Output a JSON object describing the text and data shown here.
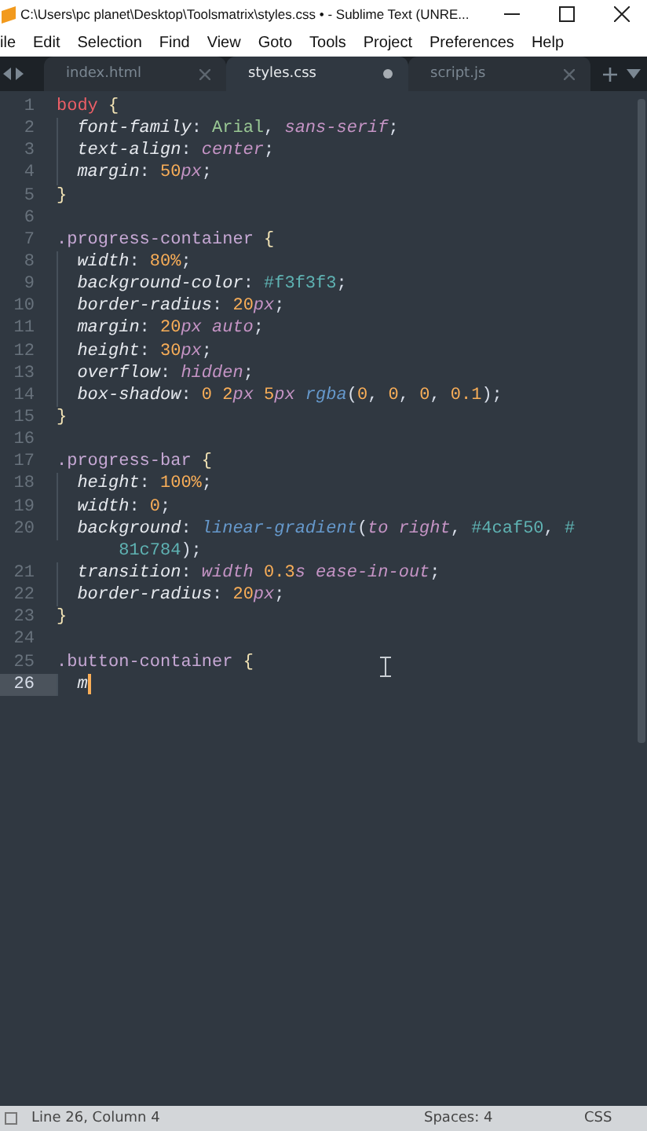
{
  "window": {
    "title": "C:\\Users\\pc planet\\Desktop\\Toolsmatrix\\styles.css • - Sublime Text (UNRE..."
  },
  "menu": [
    "ile",
    "Edit",
    "Selection",
    "Find",
    "View",
    "Goto",
    "Tools",
    "Project",
    "Preferences",
    "Help"
  ],
  "tabs": [
    {
      "label": "index.html",
      "selected": false,
      "dirty": false
    },
    {
      "label": "styles.css",
      "selected": true,
      "dirty": true
    },
    {
      "label": "script.js",
      "selected": false,
      "dirty": false
    }
  ],
  "editor": {
    "lines": [
      {
        "number": "1",
        "indent": false,
        "current": false,
        "tokens": [
          {
            "text": "body",
            "kind": "tag"
          },
          {
            "text": " {",
            "kind": "brace"
          }
        ]
      },
      {
        "number": "2",
        "indent": true,
        "current": false,
        "tokens": [
          {
            "text": "font-family",
            "kind": "prop"
          },
          {
            "text": ": ",
            "kind": "punct"
          },
          {
            "text": "Arial",
            "kind": "str"
          },
          {
            "text": ", ",
            "kind": "punct"
          },
          {
            "text": "sans-serif",
            "kind": "kw"
          },
          {
            "text": ";",
            "kind": "punct"
          }
        ]
      },
      {
        "number": "3",
        "indent": true,
        "current": false,
        "tokens": [
          {
            "text": "text-align",
            "kind": "prop"
          },
          {
            "text": ": ",
            "kind": "punct"
          },
          {
            "text": "center",
            "kind": "kw"
          },
          {
            "text": ";",
            "kind": "punct"
          }
        ]
      },
      {
        "number": "4",
        "indent": true,
        "current": false,
        "tokens": [
          {
            "text": "margin",
            "kind": "prop"
          },
          {
            "text": ": ",
            "kind": "punct"
          },
          {
            "text": "50",
            "kind": "num"
          },
          {
            "text": "px",
            "kind": "unit"
          },
          {
            "text": ";",
            "kind": "punct"
          }
        ]
      },
      {
        "number": "5",
        "indent": false,
        "current": false,
        "tokens": [
          {
            "text": "}",
            "kind": "brace"
          }
        ]
      },
      {
        "number": "6",
        "current": false
      },
      {
        "number": "7",
        "indent": false,
        "current": false,
        "tokens": [
          {
            "text": ".progress-container",
            "kind": "cls"
          },
          {
            "text": " {",
            "kind": "brace"
          }
        ]
      },
      {
        "number": "8",
        "indent": true,
        "current": false,
        "tokens": [
          {
            "text": "width",
            "kind": "prop"
          },
          {
            "text": ": ",
            "kind": "punct"
          },
          {
            "text": "80%",
            "kind": "num"
          },
          {
            "text": ";",
            "kind": "punct"
          }
        ]
      },
      {
        "number": "9",
        "indent": true,
        "current": false,
        "tokens": [
          {
            "text": "background-color",
            "kind": "prop"
          },
          {
            "text": ": ",
            "kind": "punct"
          },
          {
            "text": "#f3f3f3",
            "kind": "hex"
          },
          {
            "text": ";",
            "kind": "punct"
          }
        ]
      },
      {
        "number": "10",
        "indent": true,
        "current": false,
        "tokens": [
          {
            "text": "border-radius",
            "kind": "prop"
          },
          {
            "text": ": ",
            "kind": "punct"
          },
          {
            "text": "20",
            "kind": "num"
          },
          {
            "text": "px",
            "kind": "unit"
          },
          {
            "text": ";",
            "kind": "punct"
          }
        ]
      },
      {
        "number": "11",
        "indent": true,
        "current": false,
        "tokens": [
          {
            "text": "margin",
            "kind": "prop"
          },
          {
            "text": ": ",
            "kind": "punct"
          },
          {
            "text": "20",
            "kind": "num"
          },
          {
            "text": "px",
            "kind": "unit"
          },
          {
            "text": " auto",
            "kind": "kw"
          },
          {
            "text": ";",
            "kind": "punct"
          }
        ]
      },
      {
        "number": "12",
        "indent": true,
        "current": false,
        "tokens": [
          {
            "text": "height",
            "kind": "prop"
          },
          {
            "text": ": ",
            "kind": "punct"
          },
          {
            "text": "30",
            "kind": "num"
          },
          {
            "text": "px",
            "kind": "unit"
          },
          {
            "text": ";",
            "kind": "punct"
          }
        ]
      },
      {
        "number": "13",
        "indent": true,
        "current": false,
        "tokens": [
          {
            "text": "overflow",
            "kind": "prop"
          },
          {
            "text": ": ",
            "kind": "punct"
          },
          {
            "text": "hidden",
            "kind": "kw"
          },
          {
            "text": ";",
            "kind": "punct"
          }
        ]
      },
      {
        "number": "14",
        "indent": true,
        "current": false,
        "tokens": [
          {
            "text": "box-shadow",
            "kind": "prop"
          },
          {
            "text": ": ",
            "kind": "punct"
          },
          {
            "text": "0 2",
            "kind": "num"
          },
          {
            "text": "px",
            "kind": "unit"
          },
          {
            "text": " 5",
            "kind": "num"
          },
          {
            "text": "px",
            "kind": "unit"
          },
          {
            "text": " rgba",
            "kind": "func"
          },
          {
            "text": "(",
            "kind": "punct"
          },
          {
            "text": "0",
            "kind": "num"
          },
          {
            "text": ", ",
            "kind": "punct"
          },
          {
            "text": "0",
            "kind": "num"
          },
          {
            "text": ", ",
            "kind": "punct"
          },
          {
            "text": "0",
            "kind": "num"
          },
          {
            "text": ", ",
            "kind": "punct"
          },
          {
            "text": "0.1",
            "kind": "num"
          },
          {
            "text": ");",
            "kind": "punct"
          }
        ]
      },
      {
        "number": "15",
        "indent": false,
        "current": false,
        "tokens": [
          {
            "text": "}",
            "kind": "brace"
          }
        ]
      },
      {
        "number": "16",
        "current": false
      },
      {
        "number": "17",
        "indent": false,
        "current": false,
        "tokens": [
          {
            "text": ".progress-bar",
            "kind": "cls"
          },
          {
            "text": " {",
            "kind": "brace"
          }
        ]
      },
      {
        "number": "18",
        "indent": true,
        "current": false,
        "tokens": [
          {
            "text": "height",
            "kind": "prop"
          },
          {
            "text": ": ",
            "kind": "punct"
          },
          {
            "text": "100%",
            "kind": "num"
          },
          {
            "text": ";",
            "kind": "punct"
          }
        ]
      },
      {
        "number": "19",
        "indent": true,
        "current": false,
        "tokens": [
          {
            "text": "width",
            "kind": "prop"
          },
          {
            "text": ": ",
            "kind": "punct"
          },
          {
            "text": "0",
            "kind": "num"
          },
          {
            "text": ";",
            "kind": "punct"
          }
        ]
      },
      {
        "number": "20",
        "indent": true,
        "current": false,
        "tokens": [
          {
            "text": "background",
            "kind": "prop"
          },
          {
            "text": ": ",
            "kind": "punct"
          },
          {
            "text": "linear-gradient",
            "kind": "func"
          },
          {
            "text": "(",
            "kind": "punct"
          },
          {
            "text": "to right",
            "kind": "kw"
          },
          {
            "text": ", ",
            "kind": "punct"
          },
          {
            "text": "#4caf50",
            "kind": "hex"
          },
          {
            "text": ", ",
            "kind": "punct"
          },
          {
            "text": "#",
            "kind": "hex"
          }
        ],
        "wrap": [
          {
            "text": "81c784",
            "kind": "hex"
          },
          {
            "text": ");",
            "kind": "punct"
          }
        ]
      },
      {
        "number": "21",
        "indent": true,
        "current": false,
        "tokens": [
          {
            "text": "transition",
            "kind": "prop"
          },
          {
            "text": ": ",
            "kind": "punct"
          },
          {
            "text": "width",
            "kind": "kw"
          },
          {
            "text": " 0.3",
            "kind": "num"
          },
          {
            "text": "s",
            "kind": "unit"
          },
          {
            "text": " ease-in-out",
            "kind": "kw"
          },
          {
            "text": ";",
            "kind": "punct"
          }
        ]
      },
      {
        "number": "22",
        "indent": true,
        "current": false,
        "tokens": [
          {
            "text": "border-radius",
            "kind": "prop"
          },
          {
            "text": ": ",
            "kind": "punct"
          },
          {
            "text": "20",
            "kind": "num"
          },
          {
            "text": "px",
            "kind": "unit"
          },
          {
            "text": ";",
            "kind": "punct"
          }
        ]
      },
      {
        "number": "23",
        "indent": false,
        "current": false,
        "tokens": [
          {
            "text": "}",
            "kind": "brace"
          }
        ]
      },
      {
        "number": "24",
        "current": false
      },
      {
        "number": "25",
        "indent": false,
        "current": false,
        "tokens": [
          {
            "text": ".button-container",
            "kind": "cls"
          },
          {
            "text": " {",
            "kind": "brace"
          }
        ]
      },
      {
        "number": "26",
        "indent": true,
        "current": true,
        "tokens": [
          {
            "text": "m",
            "kind": "prop"
          }
        ]
      }
    ]
  },
  "status_bar": {
    "position": "Line 26, Column 4",
    "indentation": "Spaces: 4",
    "syntax": "CSS"
  }
}
